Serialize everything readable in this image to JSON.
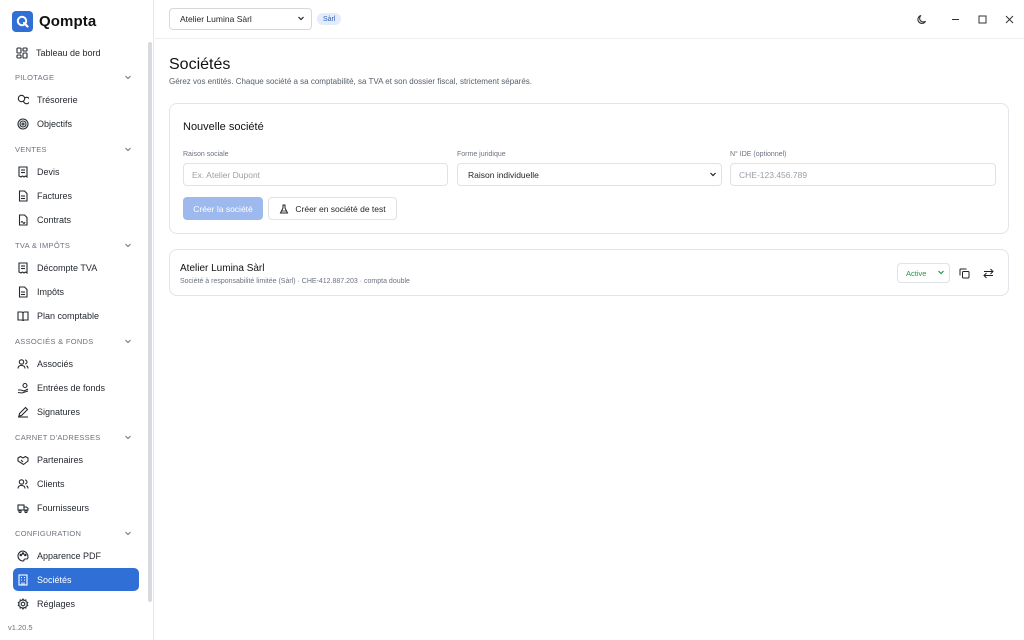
{
  "app": {
    "name": "Qompta",
    "version": "v1.20.5"
  },
  "sidebar": {
    "dashboard": "Tableau de bord",
    "sections": [
      {
        "title": "PILOTAGE",
        "items": [
          {
            "label": "Trésorerie",
            "icon": "coins-icon"
          },
          {
            "label": "Objectifs",
            "icon": "target-icon"
          }
        ]
      },
      {
        "title": "VENTES",
        "items": [
          {
            "label": "Devis",
            "icon": "receipt-icon"
          },
          {
            "label": "Factures",
            "icon": "file-text-icon"
          },
          {
            "label": "Contrats",
            "icon": "file-signature-icon"
          }
        ]
      },
      {
        "title": "TVA & IMPÔTS",
        "items": [
          {
            "label": "Décompte TVA",
            "icon": "receipt-icon"
          },
          {
            "label": "Impôts",
            "icon": "file-text-icon"
          },
          {
            "label": "Plan comptable",
            "icon": "book-open-icon"
          }
        ]
      },
      {
        "title": "ASSOCIÉS & FONDS",
        "items": [
          {
            "label": "Associés",
            "icon": "users-icon"
          },
          {
            "label": "Entrées de fonds",
            "icon": "hand-coins-icon"
          },
          {
            "label": "Signatures",
            "icon": "pen-icon"
          }
        ]
      },
      {
        "title": "CARNET D'ADRESSES",
        "items": [
          {
            "label": "Partenaires",
            "icon": "handshake-icon"
          },
          {
            "label": "Clients",
            "icon": "users-icon"
          },
          {
            "label": "Fournisseurs",
            "icon": "truck-icon"
          }
        ]
      },
      {
        "title": "CONFIGURATION",
        "items": [
          {
            "label": "Apparence PDF",
            "icon": "palette-icon"
          },
          {
            "label": "Sociétés",
            "icon": "building-icon",
            "active": true
          },
          {
            "label": "Réglages",
            "icon": "gear-icon"
          }
        ]
      }
    ]
  },
  "topbar": {
    "company": "Atelier Lumina Sàrl",
    "badge": "Sàrl"
  },
  "page": {
    "title": "Sociétés",
    "subtitle": "Gérez vos entités. Chaque société a sa comptabilité, sa TVA et son dossier fiscal, strictement séparés."
  },
  "new_company": {
    "title": "Nouvelle société",
    "name_label": "Raison sociale",
    "name_placeholder": "Ex. Atelier Dupont",
    "form_label": "Forme juridique",
    "form_value": "Raison individuelle",
    "ide_label": "N° IDE (optionnel)",
    "ide_placeholder": "CHE-123.456.789",
    "create_label": "Créer la société",
    "test_label": "Créer en société de test"
  },
  "companies": [
    {
      "name": "Atelier Lumina Sàrl",
      "meta": "Société à responsabilité limitée (Sàrl) · CHE-412.887.203 · compta double",
      "status": "Active"
    }
  ],
  "colors": {
    "accent": "#2f6fd6",
    "active_status": "#1a9c4a",
    "badge_bg": "#e3ecfb"
  }
}
